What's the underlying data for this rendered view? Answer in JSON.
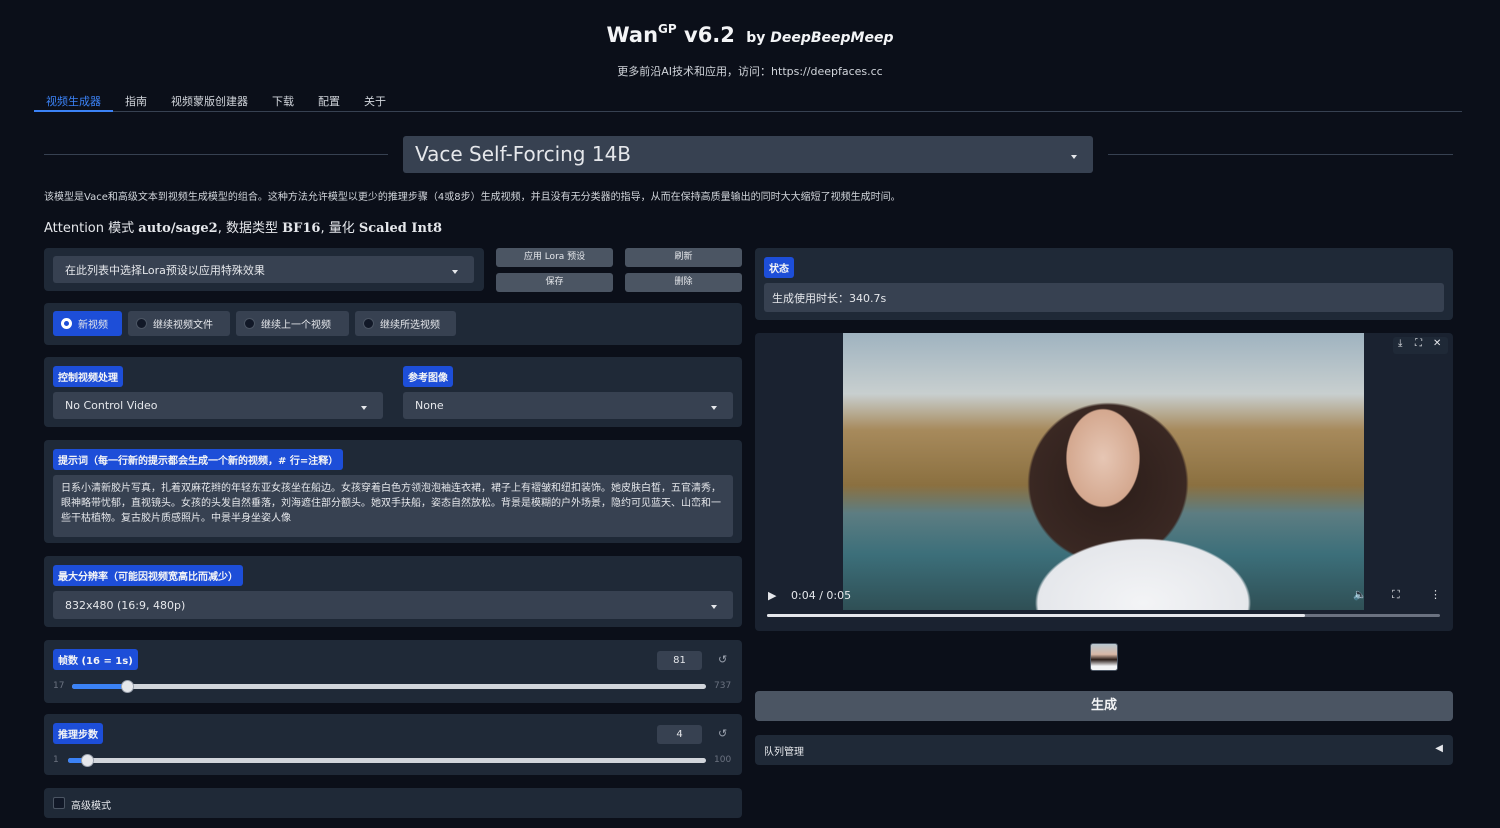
{
  "header": {
    "title_main": "Wan",
    "title_sup": "GP",
    "title_version": " v6.2",
    "title_by": "by",
    "title_author": "DeepBeepMeep",
    "subtitle": "更多前沿AI技术和应用，访问：https://deepfaces.cc"
  },
  "tabs": [
    {
      "label": "视频生成器"
    },
    {
      "label": "指南"
    },
    {
      "label": "视频蒙版创建器"
    },
    {
      "label": "下载"
    },
    {
      "label": "配置"
    },
    {
      "label": "关于"
    }
  ],
  "model": {
    "selected": "Vace Self-Forcing 14B",
    "description": "该模型是Vace和高级文本到视频生成模型的组合。这种方法允许模型以更少的推理步骤（4或8步）生成视频，并且没有无分类器的指导，从而在保持高质量输出的同时大大缩短了视频生成时间。",
    "attention_prefix": "Attention 模式",
    "attention_value": "auto/sage2",
    "dtype_prefix": ", 数据类型",
    "dtype_value": "BF16",
    "quant_prefix": ", 量化",
    "quant_value": "Scaled Int8"
  },
  "lora": {
    "placeholder": "在此列表中选择Lora预设以应用特殊效果",
    "apply_label": "应用 Lora 预设",
    "refresh_label": "刷新",
    "save_label": "保存",
    "delete_label": "删除"
  },
  "video_source": {
    "options": [
      {
        "label": "新视频",
        "selected": true
      },
      {
        "label": "继续视频文件",
        "selected": false
      },
      {
        "label": "继续上一个视频",
        "selected": false
      },
      {
        "label": "继续所选视频",
        "selected": false
      }
    ]
  },
  "control": {
    "label": "控制视频处理",
    "value": "No Control Video",
    "ref_label": "参考图像",
    "ref_value": "None"
  },
  "prompt": {
    "label": "提示词（每一行新的提示都会生成一个新的视频，# 行=注释）",
    "value": "日系小清新胶片写真，扎着双麻花辫的年轻东亚女孩坐在船边。女孩穿着白色方领泡泡袖连衣裙，裙子上有褶皱和纽扣装饰。她皮肤白皙，五官清秀，眼神略带忧郁，直视镜头。女孩的头发自然垂落，刘海遮住部分额头。她双手扶船，姿态自然放松。背景是模糊的户外场景，隐约可见蓝天、山峦和一些干枯植物。复古胶片质感照片。中景半身坐姿人像"
  },
  "resolution": {
    "label": "最大分辨率（可能因视频宽高比而减少）",
    "value": "832x480 (16:9, 480p)"
  },
  "frames": {
    "label": "帧数 (16 = 1s)",
    "value": "81",
    "min": "17",
    "max": "737",
    "fraction": 0.087
  },
  "steps": {
    "label": "推理步数",
    "value": "4",
    "min": "1",
    "max": "100",
    "fraction": 0.03
  },
  "advanced": {
    "label": "高级模式",
    "checked": false
  },
  "status": {
    "label": "状态",
    "text": "生成使用时长：340.7s"
  },
  "player": {
    "time": "0:04 / 0:05",
    "progress": 0.8
  },
  "generate_label": "生成",
  "queue_label": "队列管理",
  "icons": {
    "reset": "↺",
    "play": "▶",
    "triangle_left": "◀",
    "menu": "⋮",
    "close": "✕"
  }
}
